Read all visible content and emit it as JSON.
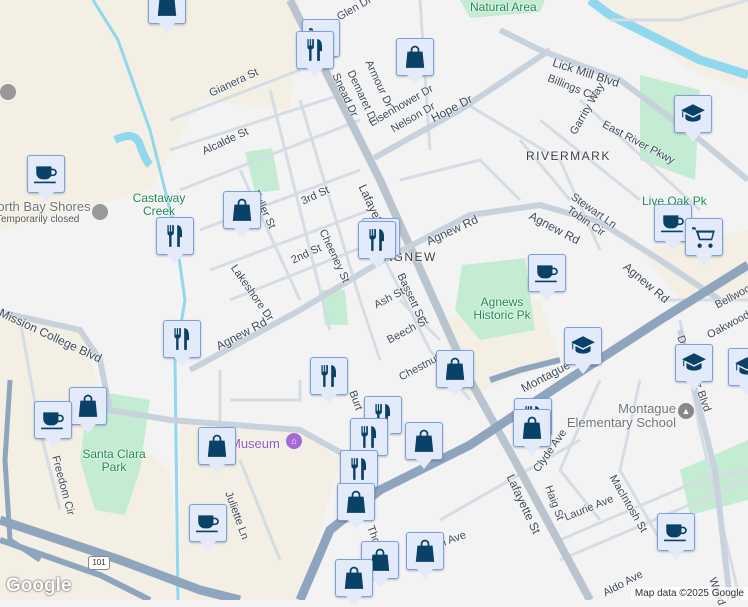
{
  "streets": {
    "glen": "Glen Dr",
    "snead": "Snead Dr",
    "demaret": "Demaret Dr",
    "armour": "Armour Dr",
    "eisenhower": "Eisenhower Dr",
    "nelson": "Nelson Dr",
    "hope": "Hope Dr",
    "gianera": "Gianera St",
    "alcalde": "Alcalde St",
    "fuller": "Fuller St",
    "third": "3rd St",
    "second": "2nd St",
    "cheeney": "Cheeney St",
    "lakeshore": "Lakeshore Dr",
    "lafayette_n": "Lafayette",
    "lafayette_s": "Lafayette St",
    "agnew_w": "Agnew Rd",
    "agnew_c": "Agnew Rd",
    "agnew_e": "Agnew Rd",
    "bassett": "Bassett St",
    "ash": "Ash St",
    "beech": "Beech St",
    "chestnut": "Chestnut",
    "mission": "Mission College Blvd",
    "freedom": "Freedom Cir",
    "lick_mill": "Lick Mill Blvd",
    "billings": "Billings Cir",
    "garrity": "Garrity Way",
    "east_river": "East River Pkwy",
    "stewart": "Stewart Ln",
    "tobin": "Tobin Cir",
    "montague": "Montague",
    "clyde": "Clyde Ave",
    "haig": "Haig St",
    "laurie": "Laurie Ave",
    "macintosh": "MacIntosh St",
    "aldo": "Aldo Ave",
    "de_la_cruz": "De La Cruz Blvd",
    "bellwood": "Bellwood",
    "oakwood": "Oakwood",
    "burt": "Burt",
    "juliette": "Juliette Ln",
    "thomas": "Thomas",
    "n_ave": "n Ave",
    "woodhams": "Wood"
  },
  "places": {
    "natural_area": "Natural Area",
    "rivermark": "RIVERMARK",
    "agnew": "AGNEW",
    "castaway": "Castaway Creek",
    "north_bay": "North Bay Shores",
    "north_bay_status": "Temporarily closed",
    "agnews_park": "Agnews Historic Pk",
    "santa_clara_park": "Santa Clara Park",
    "museum": "Museum",
    "montague_school": "Montague Elementary School",
    "live_oak": "Live Oak Pk"
  },
  "highway_shield": "101",
  "branding": {
    "logo": "Google",
    "attribution": "Map data ©2025 Google"
  },
  "colors": {
    "marker_fill": "#e3ebfb",
    "marker_border": "#7aa0df",
    "marker_icon": "#0a4166",
    "park": "#c4ecd2",
    "water": "#8fd8ee"
  }
}
